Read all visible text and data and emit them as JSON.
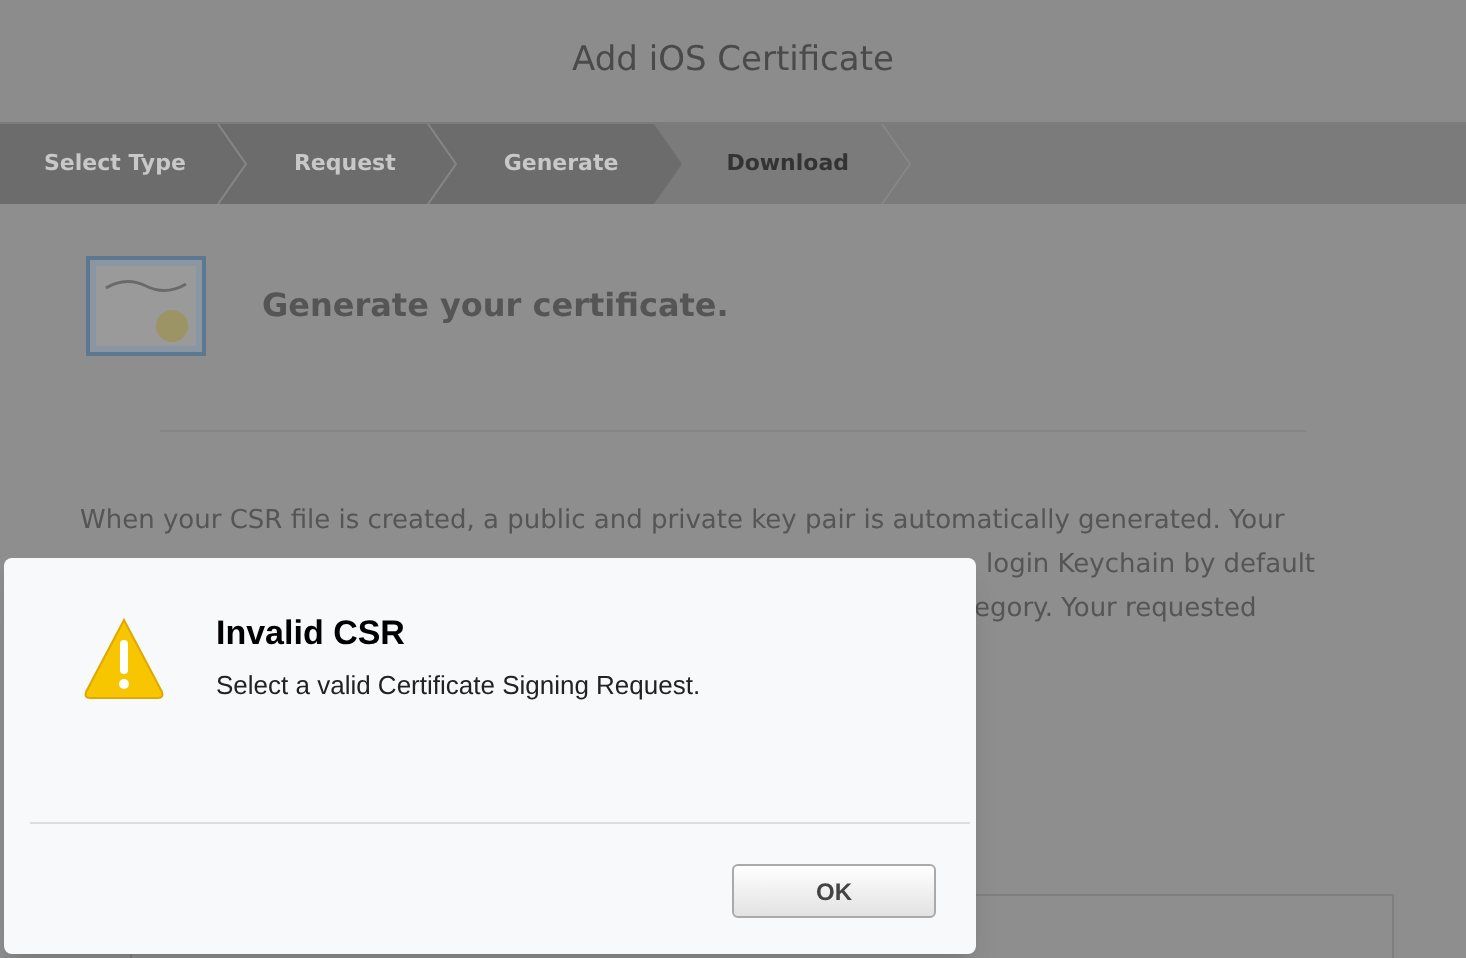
{
  "window": {
    "title": "Add iOS Certificate"
  },
  "steps": [
    {
      "label": "Select Type",
      "done": true
    },
    {
      "label": "Request",
      "done": true
    },
    {
      "label": "Generate",
      "done": true
    },
    {
      "label": "Download",
      "done": false
    }
  ],
  "heading": "Generate your certificate.",
  "paragraph_lines": [
    "When your CSR file is created, a public and private key pair is automatically generated. Your"
  ],
  "paragraph_fragments": [
    "login Keychain by default",
    "egory. Your requested"
  ],
  "dialog": {
    "title": "Invalid CSR",
    "message": "Select a valid Certificate Signing Request.",
    "buttons": [
      "OK"
    ]
  }
}
